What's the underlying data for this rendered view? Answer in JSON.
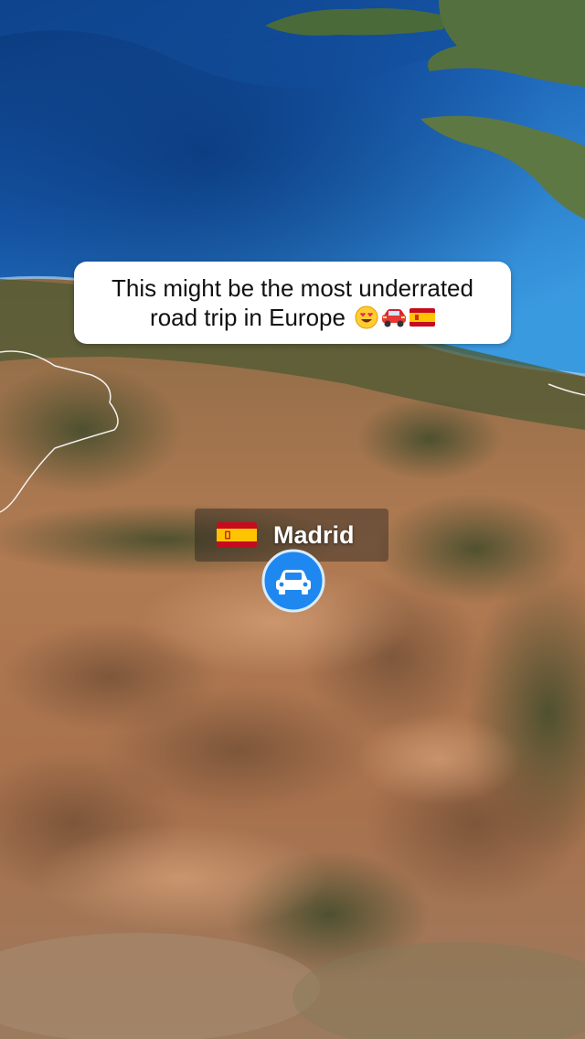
{
  "caption": {
    "line1": "This might be the most underrated",
    "line2": "road trip in Europe",
    "emojis": [
      "heart-eyes-emoji",
      "red-car-emoji",
      "spain-flag-emoji"
    ]
  },
  "marker": {
    "city": "Madrid",
    "flag_icon": "spain-flag-icon",
    "vehicle_icon": "car-icon"
  },
  "colors": {
    "ocean_deep": "#0d3f86",
    "ocean_light": "#2f86d6",
    "land_brown": "#a9764f",
    "land_green": "#4a5a32",
    "border_line": "#ffffff",
    "marker_blue": "#1e88f0",
    "caption_bg": "#ffffff",
    "spain_red": "#c60b1e",
    "spain_yellow": "#ffc400"
  }
}
